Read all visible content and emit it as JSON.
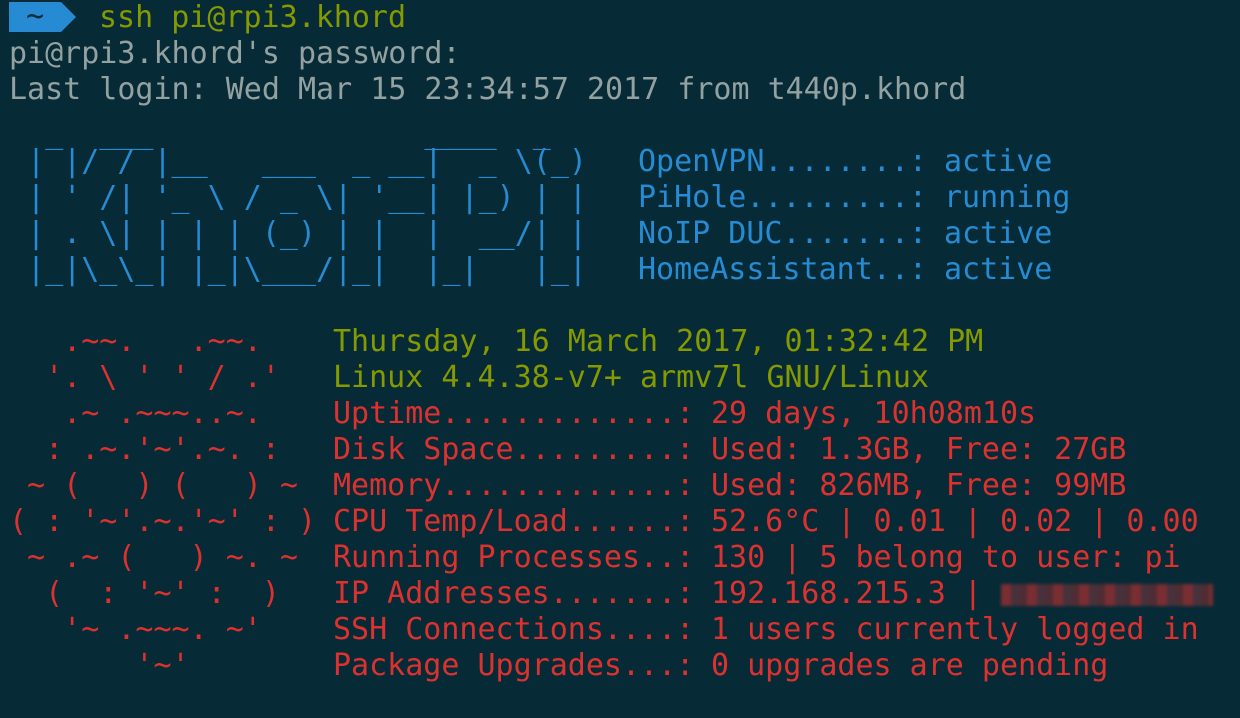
{
  "prompt": {
    "dir": "~",
    "command": "ssh pi@rpi3.khord"
  },
  "output": {
    "password_prompt": "pi@rpi3.khord's password:",
    "last_login": "Last login: Wed Mar 15 23:34:57 2017 from t440p.khord"
  },
  "banner_art": [
    "  _  ___               ____  _ ",
    " | |/ / |__   ___  _ __|  _ \\(_)",
    " | ' /| '_ \\ / _ \\| '__| |_) | |",
    " | . \\| | | | (_) | |  |  __/| |",
    " |_|\\_\\_| |_|\\___/|_|  |_|   |_|"
  ],
  "services": [
    {
      "name": "OpenVPN........:",
      "status": "active"
    },
    {
      "name": "PiHole.........:",
      "status": "running"
    },
    {
      "name": "NoIP DUC.......:",
      "status": "active"
    },
    {
      "name": "HomeAssistant..:",
      "status": "active"
    }
  ],
  "rpi_art": [
    "   .~~.   .~~.",
    "  '. \\ ' ' / .'",
    "   .~ .~~~..~.",
    "  : .~.'~'.~. :",
    " ~ (   ) (   ) ~",
    "( : '~'.~.'~' : )",
    " ~ .~ (   ) ~. ~",
    "  (  : '~' :  )",
    "   '~ .~~~. ~'",
    "       '~'"
  ],
  "system": {
    "datetime": "Thursday, 16 March 2017, 01:32:42 PM",
    "kernel": "Linux 4.4.38-v7+ armv7l GNU/Linux"
  },
  "stats": [
    {
      "label": "Uptime.............:",
      "value": "29 days, 10h08m10s"
    },
    {
      "label": "Disk Space.........:",
      "value": "Used: 1.3GB, Free: 27GB"
    },
    {
      "label": "Memory.............:",
      "value": "Used: 826MB, Free: 99MB"
    },
    {
      "label": "CPU Temp/Load......:",
      "value": "52.6°C | 0.01 | 0.02 | 0.00"
    },
    {
      "label": "Running Processes..:",
      "value": "130 | 5 belong to user: pi"
    },
    {
      "label": "IP Addresses.......:",
      "value": "192.168.215.3 |"
    },
    {
      "label": "SSH Connections....:",
      "value": "1 users currently logged in"
    },
    {
      "label": "Package Upgrades...:",
      "value": "0 upgrades are pending"
    }
  ],
  "colors": {
    "background": "#062a36",
    "prompt_bg": "#268bd2",
    "command": "#859900",
    "text": "#93a1a1",
    "accent_blue": "#268bd2",
    "accent_red": "#dc322f"
  }
}
